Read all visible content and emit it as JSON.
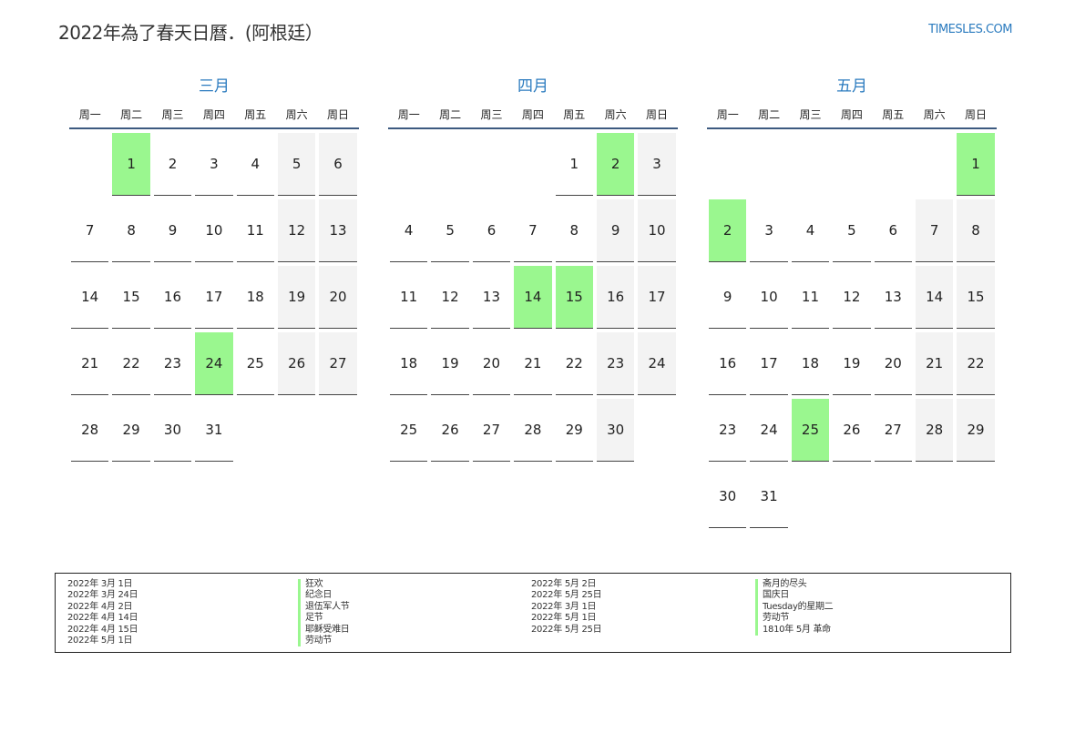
{
  "header": {
    "title": "2022年為了春天日曆．(阿根廷）",
    "site": "TIMESLES.COM"
  },
  "weekday_labels": [
    "周一",
    "周二",
    "周三",
    "周四",
    "周五",
    "周六",
    "周日"
  ],
  "months": [
    {
      "name": "三月",
      "cells": [
        null,
        1,
        2,
        3,
        4,
        5,
        6,
        7,
        8,
        9,
        10,
        11,
        12,
        13,
        14,
        15,
        16,
        17,
        18,
        19,
        20,
        21,
        22,
        23,
        24,
        25,
        26,
        27,
        28,
        29,
        30,
        31
      ],
      "holidays": [
        1,
        24
      ]
    },
    {
      "name": "四月",
      "cells": [
        null,
        null,
        null,
        null,
        1,
        2,
        3,
        4,
        5,
        6,
        7,
        8,
        9,
        10,
        11,
        12,
        13,
        14,
        15,
        16,
        17,
        18,
        19,
        20,
        21,
        22,
        23,
        24,
        25,
        26,
        27,
        28,
        29,
        30
      ],
      "holidays": [
        2,
        14,
        15
      ]
    },
    {
      "name": "五月",
      "cells": [
        null,
        null,
        null,
        null,
        null,
        null,
        1,
        2,
        3,
        4,
        5,
        6,
        7,
        8,
        9,
        10,
        11,
        12,
        13,
        14,
        15,
        16,
        17,
        18,
        19,
        20,
        21,
        22,
        23,
        24,
        25,
        26,
        27,
        28,
        29,
        30,
        31
      ],
      "holidays": [
        1,
        2,
        25
      ]
    }
  ],
  "legend": {
    "col1_dates": [
      "2022年 3月 1日",
      "2022年 3月 24日",
      "2022年 4月 2日",
      "2022年 4月 14日",
      "2022年 4月 15日",
      "2022年 5月 1日"
    ],
    "col1_names": [
      "狂欢",
      "纪念日",
      "退伍军人节",
      "足节",
      "耶稣受难日",
      "劳动节"
    ],
    "col2_dates": [
      "2022年 5月 2日",
      "2022年 5月 25日",
      "2022年 3月 1日",
      "2022年 5月 1日",
      "2022年 5月 25日"
    ],
    "col2_names": [
      "斋月的尽头",
      "国庆日",
      "Tuesday的星期二",
      "劳动节",
      "1810年 5月 革命"
    ]
  }
}
